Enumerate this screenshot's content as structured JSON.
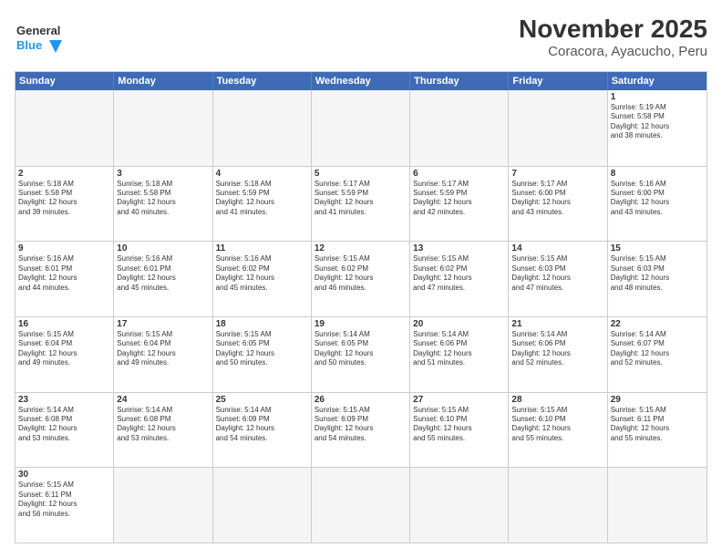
{
  "header": {
    "logo_general": "General",
    "logo_blue": "Blue",
    "title": "November 2025",
    "subtitle": "Coracora, Ayacucho, Peru"
  },
  "calendar": {
    "days_of_week": [
      "Sunday",
      "Monday",
      "Tuesday",
      "Wednesday",
      "Thursday",
      "Friday",
      "Saturday"
    ],
    "weeks": [
      [
        {
          "day": "",
          "info": "",
          "empty": true
        },
        {
          "day": "",
          "info": "",
          "empty": true
        },
        {
          "day": "",
          "info": "",
          "empty": true
        },
        {
          "day": "",
          "info": "",
          "empty": true
        },
        {
          "day": "",
          "info": "",
          "empty": true
        },
        {
          "day": "",
          "info": "",
          "empty": true
        },
        {
          "day": "1",
          "info": "Sunrise: 5:19 AM\nSunset: 5:58 PM\nDaylight: 12 hours\nand 38 minutes.",
          "empty": false
        }
      ],
      [
        {
          "day": "2",
          "info": "Sunrise: 5:18 AM\nSunset: 5:58 PM\nDaylight: 12 hours\nand 39 minutes.",
          "empty": false
        },
        {
          "day": "3",
          "info": "Sunrise: 5:18 AM\nSunset: 5:58 PM\nDaylight: 12 hours\nand 40 minutes.",
          "empty": false
        },
        {
          "day": "4",
          "info": "Sunrise: 5:18 AM\nSunset: 5:59 PM\nDaylight: 12 hours\nand 41 minutes.",
          "empty": false
        },
        {
          "day": "5",
          "info": "Sunrise: 5:17 AM\nSunset: 5:59 PM\nDaylight: 12 hours\nand 41 minutes.",
          "empty": false
        },
        {
          "day": "6",
          "info": "Sunrise: 5:17 AM\nSunset: 5:59 PM\nDaylight: 12 hours\nand 42 minutes.",
          "empty": false
        },
        {
          "day": "7",
          "info": "Sunrise: 5:17 AM\nSunset: 6:00 PM\nDaylight: 12 hours\nand 43 minutes.",
          "empty": false
        },
        {
          "day": "8",
          "info": "Sunrise: 5:16 AM\nSunset: 6:00 PM\nDaylight: 12 hours\nand 43 minutes.",
          "empty": false
        }
      ],
      [
        {
          "day": "9",
          "info": "Sunrise: 5:16 AM\nSunset: 6:01 PM\nDaylight: 12 hours\nand 44 minutes.",
          "empty": false
        },
        {
          "day": "10",
          "info": "Sunrise: 5:16 AM\nSunset: 6:01 PM\nDaylight: 12 hours\nand 45 minutes.",
          "empty": false
        },
        {
          "day": "11",
          "info": "Sunrise: 5:16 AM\nSunset: 6:02 PM\nDaylight: 12 hours\nand 45 minutes.",
          "empty": false
        },
        {
          "day": "12",
          "info": "Sunrise: 5:15 AM\nSunset: 6:02 PM\nDaylight: 12 hours\nand 46 minutes.",
          "empty": false
        },
        {
          "day": "13",
          "info": "Sunrise: 5:15 AM\nSunset: 6:02 PM\nDaylight: 12 hours\nand 47 minutes.",
          "empty": false
        },
        {
          "day": "14",
          "info": "Sunrise: 5:15 AM\nSunset: 6:03 PM\nDaylight: 12 hours\nand 47 minutes.",
          "empty": false
        },
        {
          "day": "15",
          "info": "Sunrise: 5:15 AM\nSunset: 6:03 PM\nDaylight: 12 hours\nand 48 minutes.",
          "empty": false
        }
      ],
      [
        {
          "day": "16",
          "info": "Sunrise: 5:15 AM\nSunset: 6:04 PM\nDaylight: 12 hours\nand 49 minutes.",
          "empty": false
        },
        {
          "day": "17",
          "info": "Sunrise: 5:15 AM\nSunset: 6:04 PM\nDaylight: 12 hours\nand 49 minutes.",
          "empty": false
        },
        {
          "day": "18",
          "info": "Sunrise: 5:15 AM\nSunset: 6:05 PM\nDaylight: 12 hours\nand 50 minutes.",
          "empty": false
        },
        {
          "day": "19",
          "info": "Sunrise: 5:14 AM\nSunset: 6:05 PM\nDaylight: 12 hours\nand 50 minutes.",
          "empty": false
        },
        {
          "day": "20",
          "info": "Sunrise: 5:14 AM\nSunset: 6:06 PM\nDaylight: 12 hours\nand 51 minutes.",
          "empty": false
        },
        {
          "day": "21",
          "info": "Sunrise: 5:14 AM\nSunset: 6:06 PM\nDaylight: 12 hours\nand 52 minutes.",
          "empty": false
        },
        {
          "day": "22",
          "info": "Sunrise: 5:14 AM\nSunset: 6:07 PM\nDaylight: 12 hours\nand 52 minutes.",
          "empty": false
        }
      ],
      [
        {
          "day": "23",
          "info": "Sunrise: 5:14 AM\nSunset: 6:08 PM\nDaylight: 12 hours\nand 53 minutes.",
          "empty": false
        },
        {
          "day": "24",
          "info": "Sunrise: 5:14 AM\nSunset: 6:08 PM\nDaylight: 12 hours\nand 53 minutes.",
          "empty": false
        },
        {
          "day": "25",
          "info": "Sunrise: 5:14 AM\nSunset: 6:09 PM\nDaylight: 12 hours\nand 54 minutes.",
          "empty": false
        },
        {
          "day": "26",
          "info": "Sunrise: 5:15 AM\nSunset: 6:09 PM\nDaylight: 12 hours\nand 54 minutes.",
          "empty": false
        },
        {
          "day": "27",
          "info": "Sunrise: 5:15 AM\nSunset: 6:10 PM\nDaylight: 12 hours\nand 55 minutes.",
          "empty": false
        },
        {
          "day": "28",
          "info": "Sunrise: 5:15 AM\nSunset: 6:10 PM\nDaylight: 12 hours\nand 55 minutes.",
          "empty": false
        },
        {
          "day": "29",
          "info": "Sunrise: 5:15 AM\nSunset: 6:11 PM\nDaylight: 12 hours\nand 55 minutes.",
          "empty": false
        }
      ],
      [
        {
          "day": "30",
          "info": "Sunrise: 5:15 AM\nSunset: 6:11 PM\nDaylight: 12 hours\nand 56 minutes.",
          "empty": false
        },
        {
          "day": "",
          "info": "",
          "empty": true
        },
        {
          "day": "",
          "info": "",
          "empty": true
        },
        {
          "day": "",
          "info": "",
          "empty": true
        },
        {
          "day": "",
          "info": "",
          "empty": true
        },
        {
          "day": "",
          "info": "",
          "empty": true
        },
        {
          "day": "",
          "info": "",
          "empty": true
        }
      ]
    ]
  }
}
